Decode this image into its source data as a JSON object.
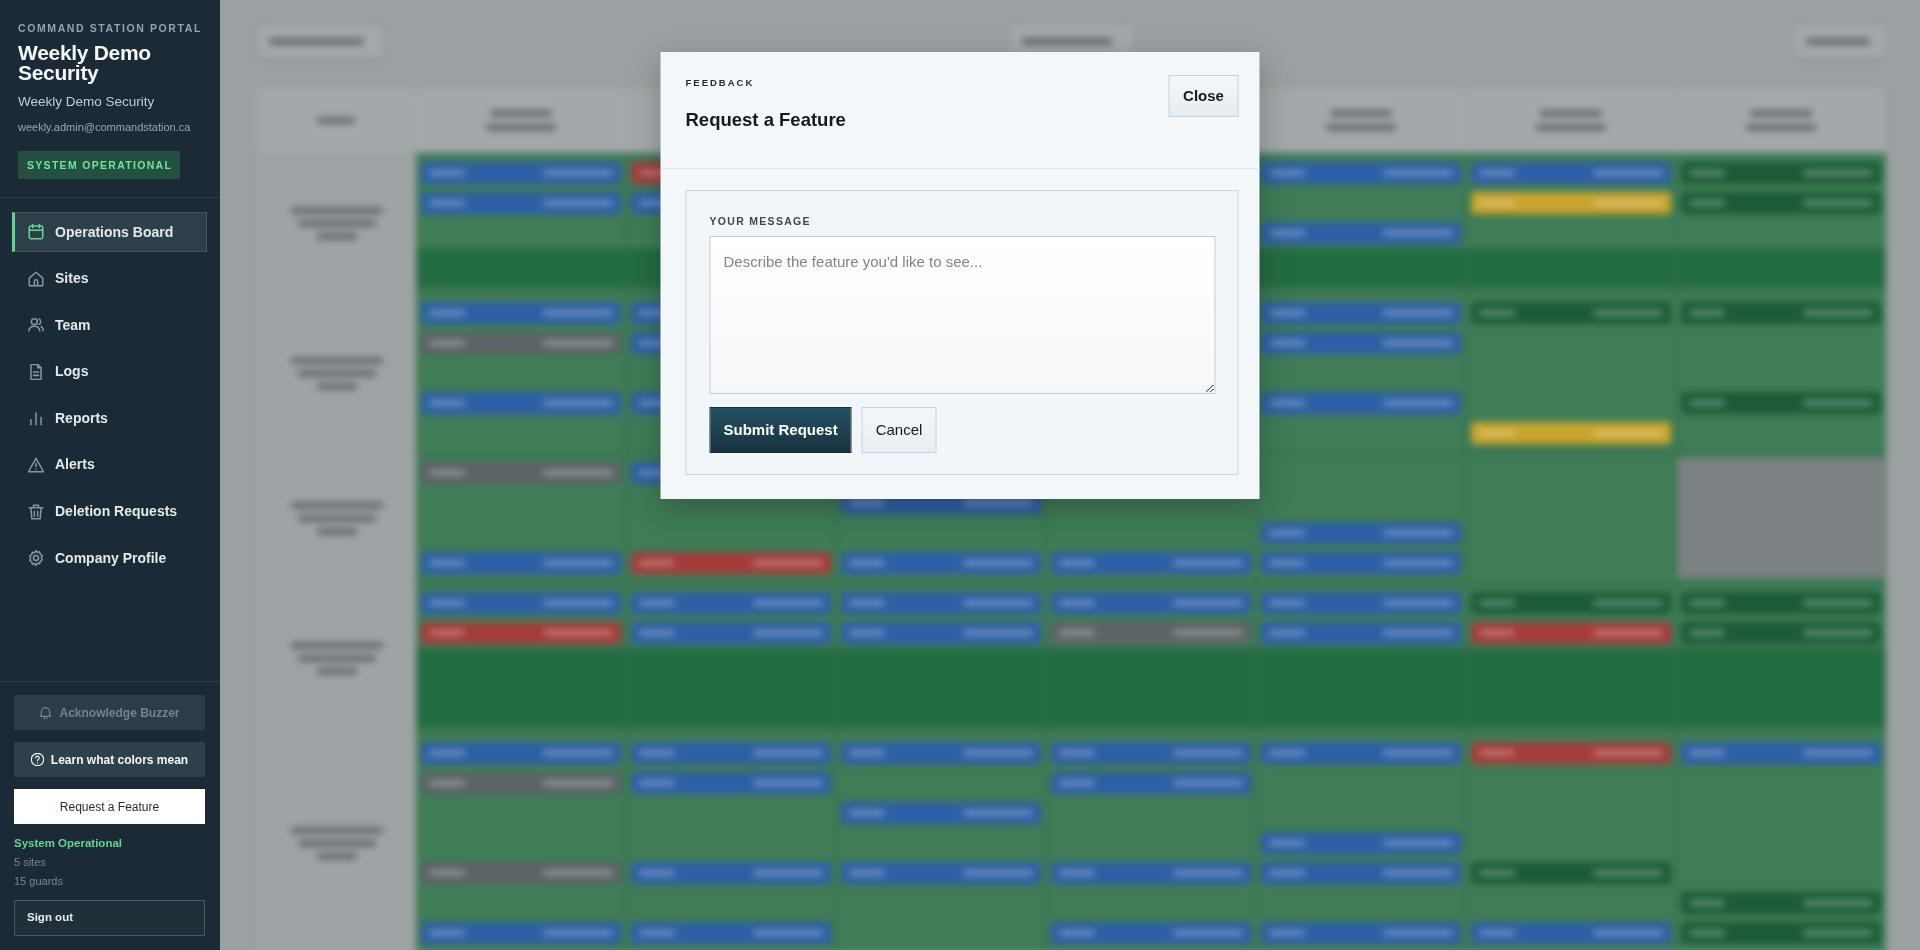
{
  "sidebar": {
    "eyebrow": "COMMAND STATION PORTAL",
    "title": "Weekly Demo Security",
    "subtitle": "Weekly Demo Security",
    "email": "weekly.admin@commandstation.ca",
    "status_badge": "SYSTEM OPERATIONAL",
    "nav": [
      {
        "label": "Operations Board",
        "selected": true
      },
      {
        "label": "Sites",
        "selected": false
      },
      {
        "label": "Team",
        "selected": false
      },
      {
        "label": "Logs",
        "selected": false
      },
      {
        "label": "Reports",
        "selected": false
      },
      {
        "label": "Alerts",
        "selected": false
      },
      {
        "label": "Deletion Requests",
        "selected": false
      },
      {
        "label": "Company Profile",
        "selected": false
      }
    ],
    "actions": [
      {
        "kind": "buzzer",
        "label": "Acknowledge Buzzer",
        "disabled": true
      },
      {
        "kind": "legend",
        "label": "Learn what colors mean",
        "disabled": false
      },
      {
        "kind": "feedback",
        "label": "Request a Feature",
        "disabled": false
      }
    ],
    "status": "System Operational",
    "site_count": "5 sites",
    "guard_count": "15 guards",
    "sign_out": "Sign out"
  },
  "dialog": {
    "eyebrow": "FEEDBACK",
    "title": "Request a Feature",
    "close": "Close",
    "field_label": "YOUR MESSAGE",
    "placeholder": "Describe the feature you'd like to see...",
    "buttons": [
      {
        "kind": "primary",
        "label": "Submit Request"
      },
      {
        "kind": "secondary",
        "label": "Cancel"
      }
    ]
  }
}
